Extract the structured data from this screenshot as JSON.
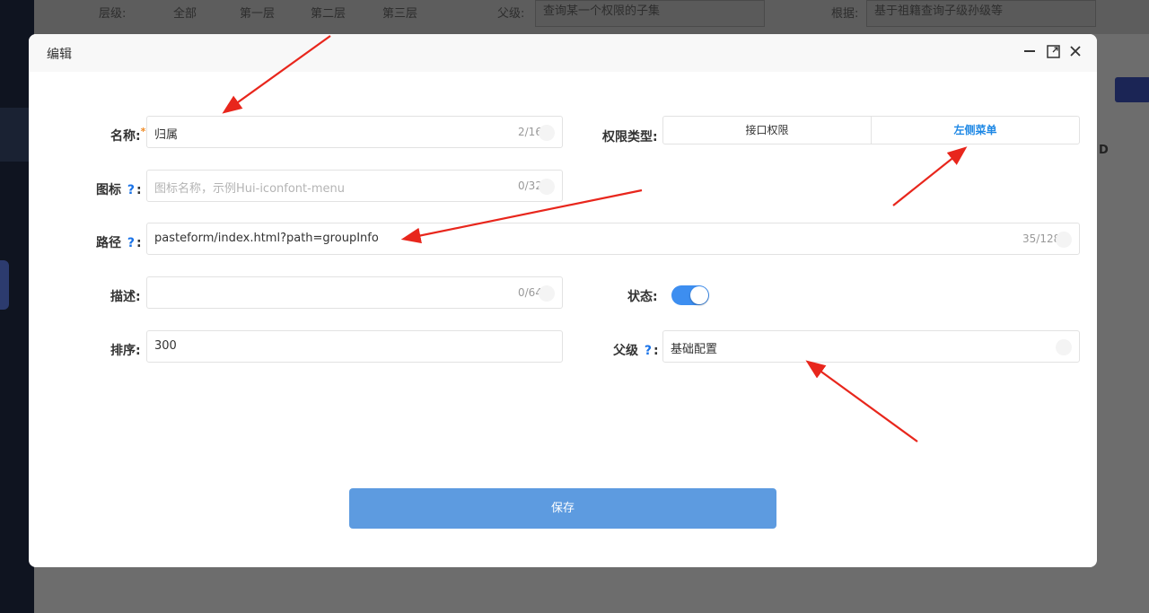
{
  "background": {
    "filter": {
      "level_label": "层级:",
      "levels": [
        "全部",
        "第一层",
        "第二层",
        "第三层"
      ],
      "parent_label": "父级:",
      "parent_placeholder": "查询某一个权限的子集",
      "by_label": "根据:",
      "by_placeholder": "基于祖籍查询子级孙级等"
    }
  },
  "modal": {
    "title": "编辑",
    "fields": {
      "name": {
        "label": "名称:",
        "required_mark": "*",
        "value": "归属",
        "counter": "2/16"
      },
      "icon": {
        "label": "图标",
        "help": "?",
        "colon": ":",
        "placeholder": "图标名称，示例Hui-iconfont-menu",
        "counter": "0/32"
      },
      "path": {
        "label": "路径",
        "help": "?",
        "colon": ":",
        "value": "pasteform/index.html?path=groupInfo",
        "counter": "35/128"
      },
      "desc": {
        "label": "描述:",
        "value": "",
        "counter": "0/64"
      },
      "sort": {
        "label": "排序:",
        "value": "300"
      },
      "perm_type": {
        "label": "权限类型:",
        "options": [
          "接口权限",
          "左侧菜单"
        ],
        "selected": "左侧菜单"
      },
      "status": {
        "label": "状态:",
        "on": true
      },
      "parent": {
        "label": "父级",
        "help": "?",
        "colon": ":",
        "value": "基础配置"
      }
    },
    "save_label": "保存"
  },
  "colors": {
    "accent": "#1e88e5",
    "toggle_on": "#3d8ef0",
    "save_button": "#5d9be0",
    "annotation_arrow": "#e8261c",
    "required": "#f08a24"
  }
}
